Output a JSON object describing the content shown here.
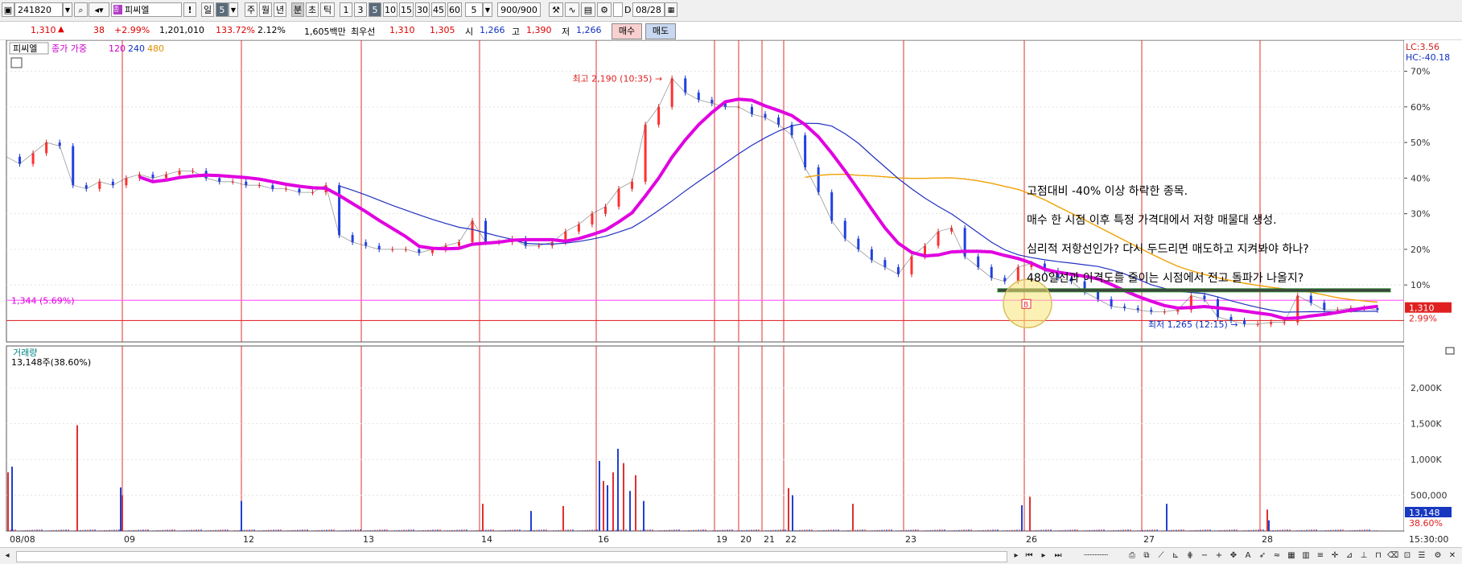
{
  "toolbar": {
    "code": "241820",
    "name": "피씨엘",
    "period_buttons": [
      "일",
      "5",
      "주",
      "월",
      "년",
      "분",
      "초",
      "틱",
      "1",
      "3",
      "5",
      "10",
      "15",
      "30",
      "45",
      "60"
    ],
    "interval_value": "5",
    "count": "900/900",
    "date": "08/28",
    "d_label": "D"
  },
  "quote": {
    "price": "1,310",
    "change": "38",
    "change_pct": "+2.99%",
    "volume": "1,201,010",
    "vol_ratio": "133.72%",
    "turnover_pct": "2.12%",
    "amount": "1,605백만",
    "best_ask_label": "최우선",
    "best_ask": "1,310",
    "best_bid": "1,305",
    "open_label": "시",
    "open": "1,266",
    "high_label": "고",
    "high": "1,390",
    "low_label": "저",
    "low": "1,266",
    "buy_label": "매수",
    "sell_label": "매도"
  },
  "legend": {
    "name": "피씨엘",
    "ma_label": "종가 가중",
    "ma120": "120",
    "ma240": "240",
    "ma480": "480",
    "volume_title": "거래량",
    "volume_current": "13,148주(38.60%)"
  },
  "scale": {
    "lc": "LC:3.56",
    "hc": "HC:-40.18",
    "price_label": "1,310",
    "pct_label": "2.99%",
    "vol_label": "13,148",
    "vol_pct_label": "38.60%",
    "time_label": "15:30:00"
  },
  "notes": [
    "고점대비 -40% 이상 하락한 종목.",
    "매수 한 시점 이후 특정 가격대에서 저항 매물대 생성.",
    "심리적 저항선인가? 다시 두드리면 매도하고 지켜봐야 하나?",
    "480일선과 이격도를 줄이는 시점에서 전고 돌파가 나올지?"
  ],
  "chart_data": {
    "type": "line",
    "title": "피씨엘",
    "y_axis": {
      "unit": "% from reference",
      "ticks": [
        "10%",
        "20%",
        "30%",
        "40%",
        "50%",
        "60%",
        "70%"
      ],
      "ylim": [
        -6,
        76
      ]
    },
    "x_axis": {
      "date_labels": [
        "08/08",
        "09",
        "12",
        "13",
        "14",
        "16",
        "19",
        "20",
        "21",
        "22",
        "23",
        "26",
        "27",
        "28"
      ]
    },
    "annotations": {
      "high": "최고 2,190 (10:35)",
      "low": "최저 1,265 (12:15)",
      "ref_line": "1,344 (5.69%)",
      "ref_pct": 5.69,
      "buy_marker": "B",
      "resistance_pct": 8.5
    },
    "series": [
      {
        "name": "종가",
        "values": [
          46,
          44,
          47,
          50,
          49,
          38,
          37,
          39,
          38,
          40,
          41,
          40,
          41,
          42,
          42,
          40,
          39,
          39,
          38,
          38,
          37,
          37,
          36,
          36,
          38,
          24,
          22,
          21,
          20,
          20,
          20,
          19,
          20,
          21,
          22,
          28,
          22,
          22,
          23,
          21,
          21,
          22,
          25,
          27,
          30,
          32,
          37,
          39,
          55,
          60,
          68,
          64,
          62,
          61,
          60,
          60,
          58,
          57,
          55,
          52,
          43,
          36,
          28,
          23,
          20,
          17,
          15,
          13,
          18,
          21,
          25,
          26,
          18,
          15,
          12,
          11,
          15,
          16,
          14,
          12,
          11,
          8,
          6,
          4,
          3.5,
          3,
          2.5,
          2.5,
          3,
          7,
          6,
          1,
          0,
          -1,
          -1,
          -0.5,
          -0.5,
          7,
          5,
          3,
          3,
          3.5,
          3.5,
          3
        ]
      },
      {
        "name": "120",
        "color": "#e000e0"
      },
      {
        "name": "240",
        "color": "#2030c0"
      },
      {
        "name": "480",
        "color": "#f0a000"
      }
    ]
  },
  "volume_data": {
    "ticks": [
      "500,000",
      "1,000K",
      "1,500K",
      "2,000K"
    ],
    "ymax": 2250000,
    "spikes": [
      {
        "x": 10,
        "v": 820000
      },
      {
        "x": 15,
        "v": 900000
      },
      {
        "x": 96,
        "v": 1480000
      },
      {
        "x": 150,
        "v": 610000
      },
      {
        "x": 152,
        "v": 500000
      },
      {
        "x": 300,
        "v": 420000
      },
      {
        "x": 600,
        "v": 380000
      },
      {
        "x": 660,
        "v": 280000
      },
      {
        "x": 700,
        "v": 350000
      },
      {
        "x": 745,
        "v": 980000
      },
      {
        "x": 750,
        "v": 700000
      },
      {
        "x": 755,
        "v": 640000
      },
      {
        "x": 762,
        "v": 820000
      },
      {
        "x": 768,
        "v": 1150000
      },
      {
        "x": 775,
        "v": 950000
      },
      {
        "x": 783,
        "v": 560000
      },
      {
        "x": 790,
        "v": 780000
      },
      {
        "x": 800,
        "v": 420000
      },
      {
        "x": 980,
        "v": 600000
      },
      {
        "x": 985,
        "v": 500000
      },
      {
        "x": 1060,
        "v": 380000
      },
      {
        "x": 1270,
        "v": 360000
      },
      {
        "x": 1280,
        "v": 480000
      },
      {
        "x": 1450,
        "v": 380000
      },
      {
        "x": 1575,
        "v": 300000
      },
      {
        "x": 1577,
        "v": 150000
      }
    ]
  }
}
